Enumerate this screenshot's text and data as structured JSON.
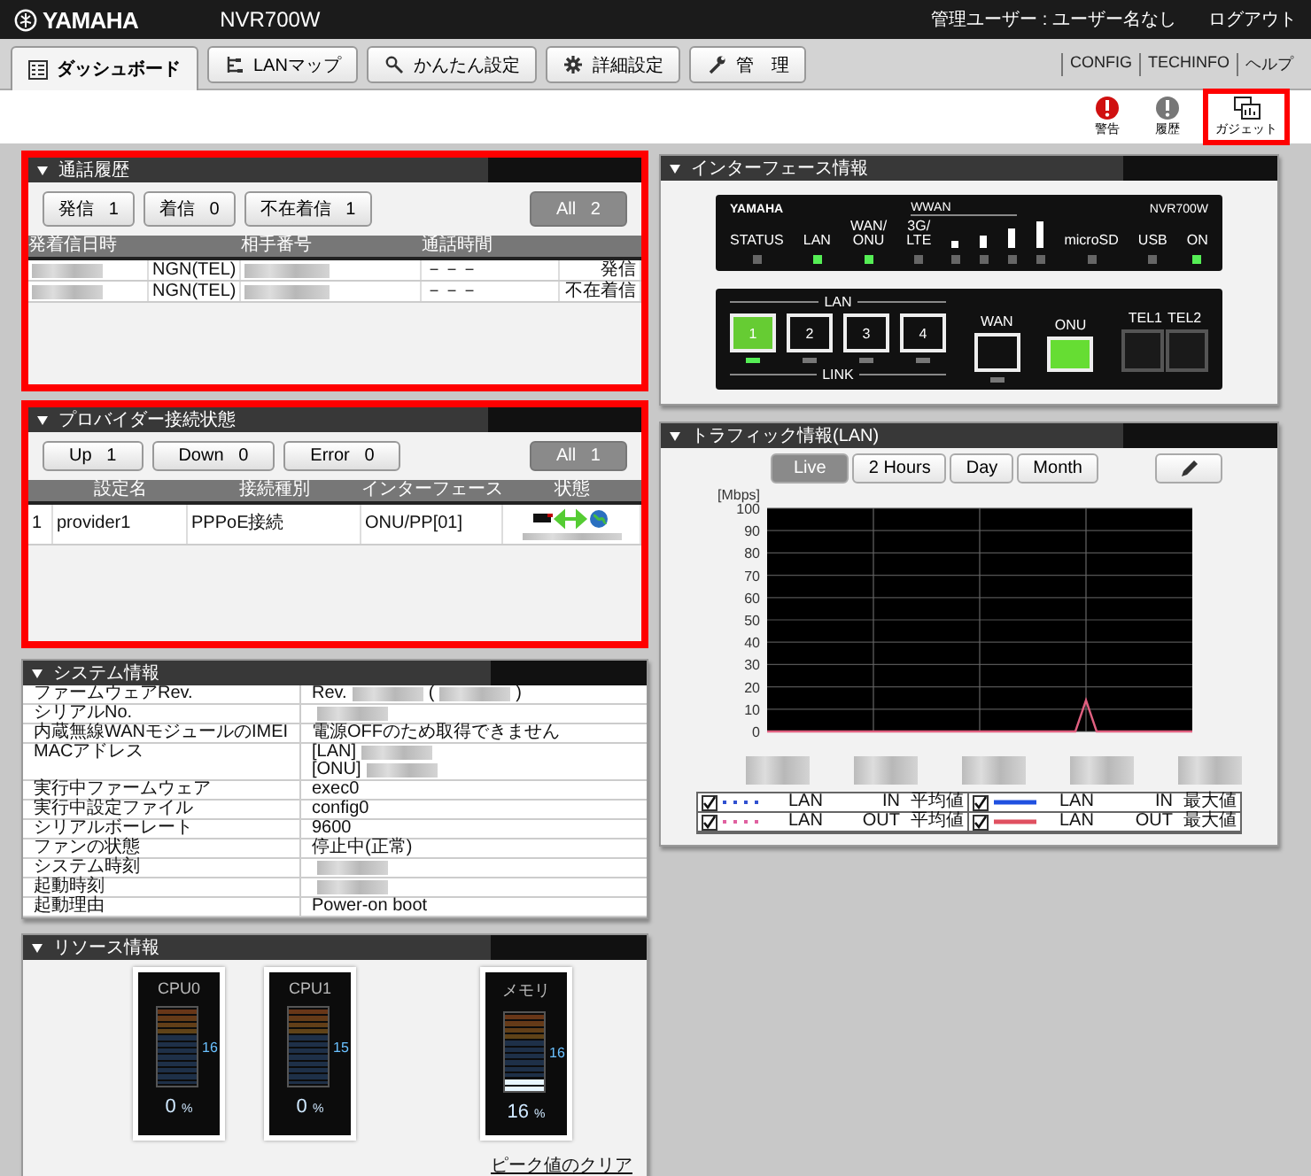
{
  "header": {
    "brand": "YAMAHA",
    "model": "NVR700W",
    "user": "管理ユーザー : ユーザー名なし",
    "logout": "ログアウト"
  },
  "tabs": [
    {
      "label": "ダッシュボード",
      "selected": true
    },
    {
      "label": "LANマップ",
      "selected": false
    },
    {
      "label": "かんたん設定",
      "selected": false
    },
    {
      "label": "詳細設定",
      "selected": false
    },
    {
      "label": "管　理",
      "selected": false
    }
  ],
  "links": [
    "CONFIG",
    "TECHINFO",
    "ヘルプ"
  ],
  "tools": [
    {
      "label": "警告",
      "highlighted": false
    },
    {
      "label": "履歴",
      "highlighted": false
    },
    {
      "label": "ガジェット",
      "highlighted": true
    }
  ],
  "call_history": {
    "title": "通話履歴",
    "highlighted": true,
    "filters": [
      {
        "label": "発信",
        "count": "1",
        "selected": false
      },
      {
        "label": "着信",
        "count": "0",
        "selected": false
      },
      {
        "label": "不在着信",
        "count": "1",
        "selected": false
      },
      {
        "label": "All",
        "count": "2",
        "selected": true
      }
    ],
    "columns": {
      "date": "発着信日時",
      "number": "相手番号",
      "duration": "通話時間"
    },
    "rows": [
      {
        "line": "NGN(TEL)",
        "duration": "－－－",
        "type": "発信"
      },
      {
        "line": "NGN(TEL)",
        "duration": "－－－",
        "type": "不在着信"
      }
    ]
  },
  "provider": {
    "title": "プロバイダー接続状態",
    "highlighted": true,
    "filters": [
      {
        "label": "Up",
        "count": "1",
        "selected": false
      },
      {
        "label": "Down",
        "count": "0",
        "selected": false
      },
      {
        "label": "Error",
        "count": "0",
        "selected": false
      },
      {
        "label": "All",
        "count": "1",
        "selected": true
      }
    ],
    "columns": [
      "設定名",
      "接続種別",
      "インターフェース",
      "状態"
    ],
    "rows": [
      {
        "index": "1",
        "name": "provider1",
        "type": "PPPoE接続",
        "interface": "ONU/PP[01]"
      }
    ]
  },
  "system_info": {
    "title": "システム情報",
    "rows": [
      {
        "label": "ファームウェアRev.",
        "parts": [
          {
            "kind": "text",
            "text": "Rev."
          },
          {
            "kind": "blur"
          },
          {
            "kind": "text",
            "text": "("
          },
          {
            "kind": "blur"
          },
          {
            "kind": "text",
            "text": ")"
          }
        ]
      },
      {
        "label": "シリアルNo.",
        "parts": [
          {
            "kind": "blur"
          }
        ]
      },
      {
        "label": "内蔵無線WANモジュールのIMEI",
        "parts": [
          {
            "kind": "text",
            "text": "電源OFFのため取得できません"
          }
        ]
      },
      {
        "label": "MACアドレス",
        "parts": [
          {
            "kind": "text",
            "text": "[LAN]"
          },
          {
            "kind": "blur"
          },
          {
            "kind": "break"
          },
          {
            "kind": "text",
            "text": "[ONU]"
          },
          {
            "kind": "blur"
          }
        ]
      },
      {
        "label": "実行中ファームウェア",
        "parts": [
          {
            "kind": "text",
            "text": "exec0"
          }
        ]
      },
      {
        "label": "実行中設定ファイル",
        "parts": [
          {
            "kind": "text",
            "text": "config0"
          }
        ]
      },
      {
        "label": "シリアルボーレート",
        "parts": [
          {
            "kind": "text",
            "text": "9600"
          }
        ]
      },
      {
        "label": "ファンの状態",
        "parts": [
          {
            "kind": "text",
            "text": "停止中(正常)"
          }
        ]
      },
      {
        "label": "システム時刻",
        "parts": [
          {
            "kind": "blur"
          }
        ]
      },
      {
        "label": "起動時刻",
        "parts": [
          {
            "kind": "blur"
          }
        ]
      },
      {
        "label": "起動理由",
        "parts": [
          {
            "kind": "text",
            "text": "Power-on boot"
          }
        ]
      }
    ]
  },
  "resources": {
    "title": "リソース情報",
    "gauges": [
      {
        "label": "CPU0",
        "level": 0,
        "peak": "16",
        "reading": "0",
        "unit": "%"
      },
      {
        "label": "CPU1",
        "level": 0,
        "peak": "15",
        "reading": "0",
        "unit": "%"
      },
      {
        "label": "メモリ",
        "level": 0.16,
        "peak": "16",
        "reading": "16",
        "unit": "%"
      }
    ],
    "clear_link": "ピーク値のクリア"
  },
  "interface": {
    "title": "インターフェース情報",
    "brand": "YAMAHA",
    "wwan": "WWAN",
    "model": "NVR700W",
    "leds": [
      {
        "kind": "led",
        "label": "STATUS",
        "on": false
      },
      {
        "kind": "led",
        "label": "LAN",
        "on": true
      },
      {
        "kind": "led",
        "label": "WAN/\nONU",
        "on": true
      },
      {
        "kind": "led",
        "label": "3G/\nLTE",
        "on": false
      },
      {
        "kind": "signal",
        "on": false
      },
      {
        "kind": "signal",
        "on": false
      },
      {
        "kind": "signal",
        "on": false
      },
      {
        "kind": "signal",
        "on": false
      },
      {
        "kind": "led",
        "label": "microSD",
        "on": false
      },
      {
        "kind": "led",
        "label": "USB",
        "on": false
      },
      {
        "kind": "led",
        "label": "ON",
        "on": true
      }
    ],
    "lan_label": "LAN",
    "link_label": "LINK",
    "lan_ports": [
      {
        "label": "1",
        "on": true
      },
      {
        "label": "2",
        "on": false
      },
      {
        "label": "3",
        "on": false
      },
      {
        "label": "4",
        "on": false
      }
    ],
    "wan": {
      "label": "WAN",
      "on": false
    },
    "onu": {
      "label": "ONU",
      "on": true
    },
    "tel": [
      "TEL1",
      "TEL2"
    ]
  },
  "traffic": {
    "title": "トラフィック情報(LAN)",
    "ranges": [
      {
        "label": "Live",
        "selected": true
      },
      {
        "label": "2 Hours",
        "selected": false
      },
      {
        "label": "Day",
        "selected": false
      },
      {
        "label": "Month",
        "selected": false
      }
    ],
    "chart_data": {
      "type": "line",
      "grid": true,
      "ylabel": "[Mbps]",
      "ylim": [
        0,
        100
      ],
      "yticks": [
        0,
        10,
        20,
        30,
        40,
        50,
        60,
        70,
        80,
        90,
        100
      ],
      "series": [
        {
          "color": "#e06080",
          "values": [
            0,
            0,
            0,
            0,
            0,
            0,
            0,
            0,
            0,
            0,
            0,
            0,
            0,
            0,
            0,
            0,
            0,
            0,
            0,
            0,
            0,
            0,
            0,
            0,
            0,
            0,
            0,
            0,
            0,
            0,
            14,
            0,
            0,
            0,
            0,
            0,
            0,
            0,
            0,
            0,
            0
          ]
        }
      ]
    },
    "legend": [
      {
        "checked": true,
        "kind": "dotted",
        "color": "#3050d0",
        "interface": "LAN",
        "direction": "IN",
        "stat": "平均値"
      },
      {
        "checked": true,
        "kind": "solid",
        "color": "#2050e0",
        "interface": "LAN",
        "direction": "IN",
        "stat": "最大値"
      },
      {
        "checked": true,
        "kind": "dotted",
        "color": "#e060a0",
        "interface": "LAN",
        "direction": "OUT",
        "stat": "平均値"
      },
      {
        "checked": true,
        "kind": "solid",
        "color": "#e05060",
        "interface": "LAN",
        "direction": "OUT",
        "stat": "最大値"
      }
    ]
  }
}
